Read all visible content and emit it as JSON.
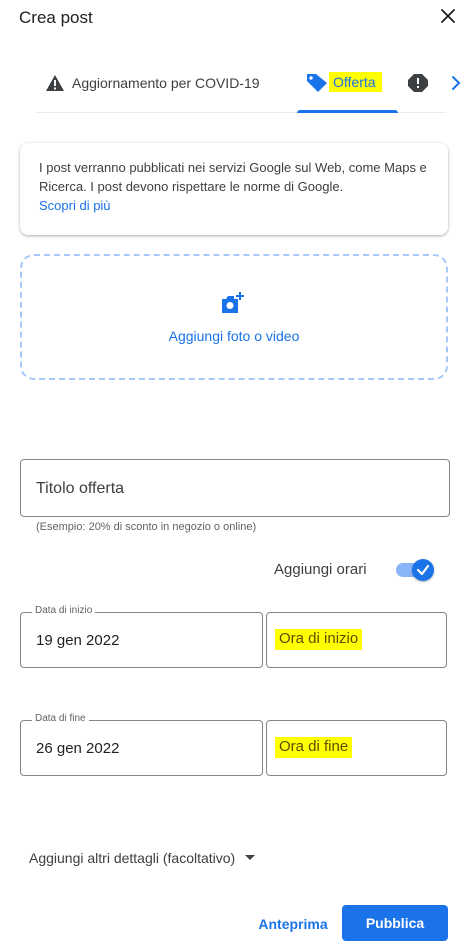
{
  "dialog": {
    "title": "Crea post",
    "close_icon": "close-icon"
  },
  "tabs": {
    "items": [
      {
        "label": "Aggiornamento per COVID-19",
        "icon": "warning-icon"
      },
      {
        "label": "Offerta",
        "icon": "tag-icon",
        "selected": true
      },
      {
        "label": "",
        "icon": "alert-badge-icon"
      }
    ],
    "next_icon": "chevron-right-icon"
  },
  "info_card": {
    "text": "I post verranno pubblicati nei servizi Google sul Web, come Maps e Ricerca. I post devono rispettare le norme di Google.",
    "link": "Scopri di più"
  },
  "media_upload": {
    "icon": "add-photo-icon",
    "label": "Aggiungi foto o video"
  },
  "offer_title": {
    "placeholder": "Titolo offerta",
    "helper": "(Esempio: 20% di sconto in negozio o online)"
  },
  "hours_toggle": {
    "label": "Aggiungi orari",
    "checked": true
  },
  "start": {
    "date_label": "Data di inizio",
    "date_value": "19 gen 2022",
    "time_placeholder": "Ora di inizio"
  },
  "end": {
    "date_label": "Data di fine",
    "date_value": "26 gen 2022",
    "time_placeholder": "Ora di fine"
  },
  "more_details": {
    "label": "Aggiungi altri dettagli (facoltativo)",
    "icon": "dropdown-arrow-icon"
  },
  "actions": {
    "preview_label": "Anteprima",
    "publish_label": "Pubblica"
  },
  "colors": {
    "accent": "#1a73e8",
    "highlight": "#ffff00"
  }
}
